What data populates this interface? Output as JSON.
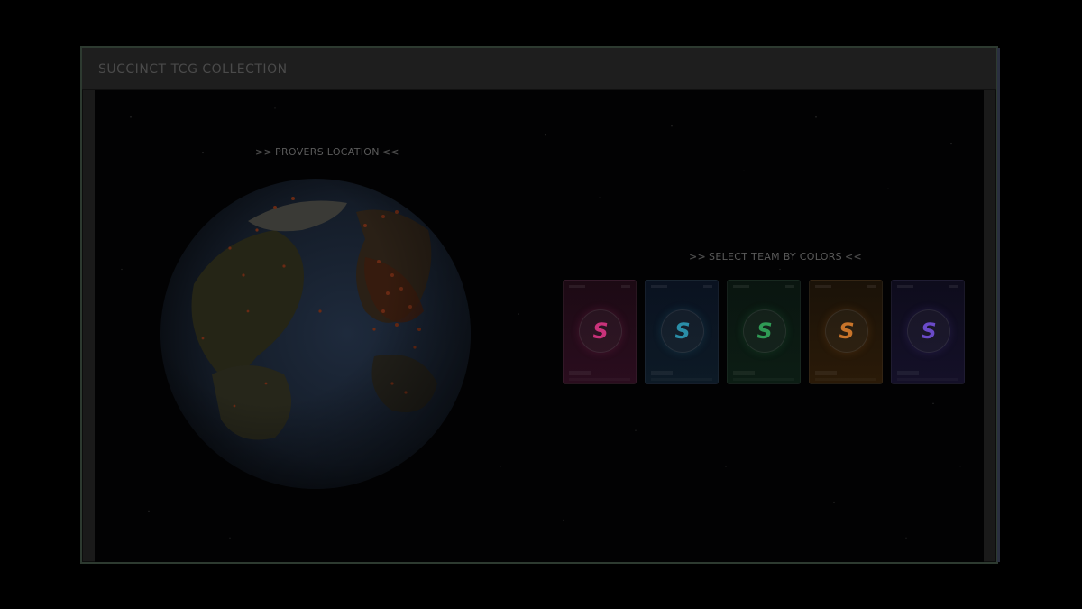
{
  "app": {
    "title": "SUCCINCT TCG COLLECTION"
  },
  "provers": {
    "label": "PROVERS LOCATION",
    "arrow_left": ">>",
    "arrow_right": "<<"
  },
  "teams": {
    "label": "SELECT TEAM BY COLORS",
    "arrow_left": ">>",
    "arrow_right": "<<",
    "cards": [
      {
        "name": "pink",
        "glyph": "S",
        "accent": "#c8327a",
        "bg_top": "#1c0a14",
        "bg_bottom": "#2a0d1e"
      },
      {
        "name": "blue",
        "glyph": "S",
        "accent": "#2a8ea8",
        "bg_top": "#0a1220",
        "bg_bottom": "#0d1a26"
      },
      {
        "name": "green",
        "glyph": "S",
        "accent": "#2f9a55",
        "bg_top": "#0a1510",
        "bg_bottom": "#0c1d14"
      },
      {
        "name": "orange",
        "glyph": "S",
        "accent": "#c8742a",
        "bg_top": "#1a1208",
        "bg_bottom": "#2a1a08"
      },
      {
        "name": "purple",
        "glyph": "S",
        "accent": "#6a4ac8",
        "bg_top": "#0e0c1c",
        "bg_bottom": "#141028"
      }
    ]
  }
}
